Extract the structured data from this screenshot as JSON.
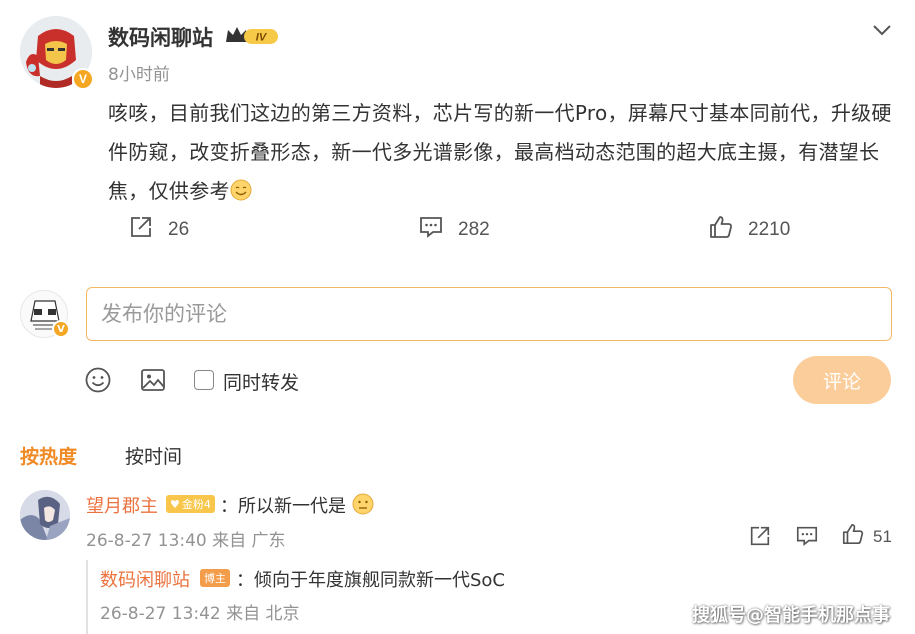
{
  "post": {
    "author": "数码闲聊站",
    "level_badge": "IV",
    "verified_mark": "V",
    "time": "8小时前",
    "text": "咳咳，目前我们这边的第三方资料，芯片写的新一代Pro，屏幕尺寸基本同前代，升级硬件防窥，改变折叠形态，新一代多光谱影像，最高档动态范围的超大底主摄，有潜望长焦，仅供参考",
    "shares": "26",
    "comments": "282",
    "likes": "2210"
  },
  "composer": {
    "placeholder": "发布你的评论",
    "repost_label": "同时转发",
    "submit_label": "评论"
  },
  "sort": {
    "hot": "按热度",
    "time": "按时间"
  },
  "comments": [
    {
      "name": "望月郡主",
      "badge": "金粉4",
      "text": "：所以新一代是",
      "meta": "26-8-27 13:40 来自 广东",
      "likes": "51",
      "reply": {
        "name": "数码闲聊站",
        "badge": "博主",
        "text": "：倾向于年度旗舰同款新一代SoC",
        "meta": "26-8-27 13:42 来自 北京"
      }
    }
  ],
  "watermark": "搜狐号@智能手机那点事",
  "colors": {
    "accent_orange": "#f08a24",
    "name_orange": "#eb7340",
    "input_border": "#f4b766",
    "submit_bg": "#fbcd9a",
    "badge_gold": "#f5a623"
  },
  "icons": [
    "ironman-avatar",
    "crown-badge-icon",
    "chevron-down-icon",
    "share-icon",
    "comment-icon",
    "like-icon",
    "emoji-icon",
    "image-icon",
    "smile-emoji"
  ]
}
